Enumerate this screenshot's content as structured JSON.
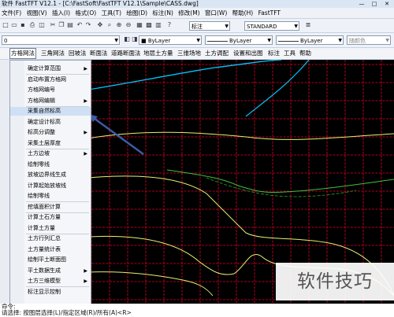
{
  "window": {
    "title": "软件 FastTFT V12.1 - [C:\\FastSoft\\FastTFT V12.1\\Sample\\CASS.dwg]",
    "controls": [
      "—",
      "□",
      "✕"
    ]
  },
  "menubar": {
    "items": [
      "文件(F)",
      "视图(V)",
      "插入(I)",
      "格式(O)",
      "工具(T)",
      "绘图(D)",
      "标注(N)",
      "修改(M)",
      "窗口(W)",
      "帮助(H)",
      "FastTFT"
    ]
  },
  "toolbar": {
    "layer_combo": "0",
    "style_combo": "标注",
    "text_style": "STANDARD",
    "color_combo": "ByLayer",
    "linetype_combo": "ByLayer",
    "lineweight_combo": "ByLayer",
    "plot_combo": "随颜色",
    "current_layer": "0"
  },
  "fastmenu": {
    "items": [
      "方格网法",
      "三角网法",
      "回坡法",
      "断面法",
      "道路断面法",
      "地层土方量",
      "三维场地",
      "土方调配",
      "设置和出图",
      "标注",
      "工具",
      "帮助"
    ],
    "active": "方格网法"
  },
  "dropdown": {
    "items": [
      {
        "label": "确定计算范围",
        "submenu": true
      },
      {
        "label": "启动布置方格网"
      },
      {
        "label": "方格网编号"
      },
      {
        "label": "方格网编辑",
        "submenu": true
      },
      {
        "label": "采集自然标高",
        "highlighted": true
      },
      {
        "label": "确定设计标高"
      },
      {
        "label": "标高分调整",
        "submenu": true
      },
      {
        "label": "采集土层厚度"
      },
      {
        "label": "土方边坡",
        "submenu": true
      },
      {
        "label": "绘制零线"
      },
      {
        "label": "放坡边界线生成"
      },
      {
        "label": "计算起始放坡线"
      },
      {
        "label": "绘制零线"
      },
      {
        "label": "挖填面积计算"
      },
      {
        "label": "计算土石方量"
      },
      {
        "label": "计算土方量"
      },
      {
        "label": "土方行列汇总"
      },
      {
        "label": "土方量统计表"
      },
      {
        "label": "绘制平土断面图"
      },
      {
        "label": "平土数据生成",
        "submenu": true
      },
      {
        "label": "土方三维模型",
        "submenu": true
      },
      {
        "label": "标注显示控制"
      }
    ]
  },
  "commandline": {
    "line1": "命令:",
    "line2": "请选择:  按图层选择(L)/指定区域(R)/所有(A)<R>"
  },
  "watermark": "软件技巧",
  "colors": {
    "grid": "#e0002a",
    "canvas": "#000000",
    "contour_cyan": "#00c8ff",
    "contour_yellow": "#e8f070",
    "contour_green": "#40c040",
    "annotation_arrow": "#3c5ca8",
    "label_white": "#ffffff"
  }
}
